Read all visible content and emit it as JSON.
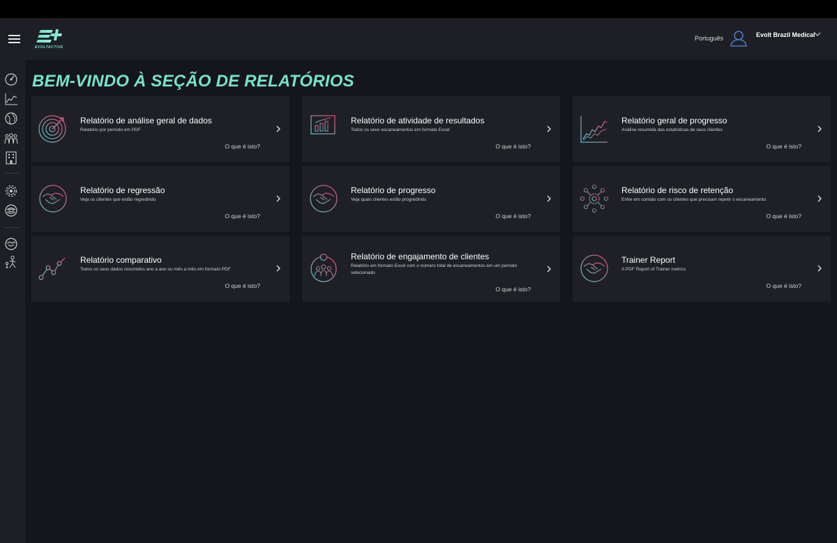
{
  "header": {
    "logo_text": "EVOLTACTIVE",
    "language": "Português",
    "user_name": "Evolt Brazil Medical"
  },
  "page_title": "BEM-VINDO À SEÇÃO DE RELATÓRIOS",
  "colors": {
    "accent": "#76e3cc",
    "card_bg": "#1e2026",
    "bg": "#15161b",
    "icon_teal": "#4fc3c8",
    "icon_pink": "#e0446a"
  },
  "sidebar": {
    "icons": [
      "dashboard-gauge-icon",
      "chart-line-icon",
      "globe-icon",
      "group-icon",
      "building-icon",
      "gear-icon",
      "sync-settings-icon",
      "handshake-icon",
      "trainer-icon"
    ]
  },
  "cards": [
    {
      "title": "Relatório de análise geral de dados",
      "desc": "Relatório por período em PDF",
      "what": "O que é isto?",
      "icon": "target-icon"
    },
    {
      "title": "Relatório de atividade de resultados",
      "desc": "Todos os seus escaneamentos em formato Excel",
      "what": "O que é isto?",
      "icon": "presentation-chart-icon"
    },
    {
      "title": "Relatório geral de progresso",
      "desc": "Análise resumida das estatísticas de seus clientes",
      "what": "O que é isto?",
      "icon": "line-chart-icon"
    },
    {
      "title": "Relatório de regressão",
      "desc": "Veja os clientes que estão regredindo",
      "what": "O que é isto?",
      "icon": "handshake-icon"
    },
    {
      "title": "Relatório de progresso",
      "desc": "Veja quais clientes estão progredindo",
      "what": "O que é isto?",
      "icon": "handshake-icon"
    },
    {
      "title": "Relatório de risco de retenção",
      "desc": "Entre em contato com os clientes que precisam repetir o escaneamento",
      "what": "O que é isto?",
      "icon": "network-gear-icon"
    },
    {
      "title": "Relatório comparativo",
      "desc": "Todos os seus dados resumidos ano a ano ou mês a mês em formato PDF",
      "what": "O que é isto?",
      "icon": "trend-line-icon"
    },
    {
      "title": "Relatório de engajamento de clientes",
      "desc": "Relatório em formato Excel com o número total de escaneamentos em um período selecionado",
      "what": "O que é isto?",
      "icon": "group-add-icon"
    },
    {
      "title": "Trainer Report",
      "desc": "A PDF Report of Trainer metrics",
      "what": "O que é isto?",
      "icon": "handshake-icon"
    }
  ]
}
